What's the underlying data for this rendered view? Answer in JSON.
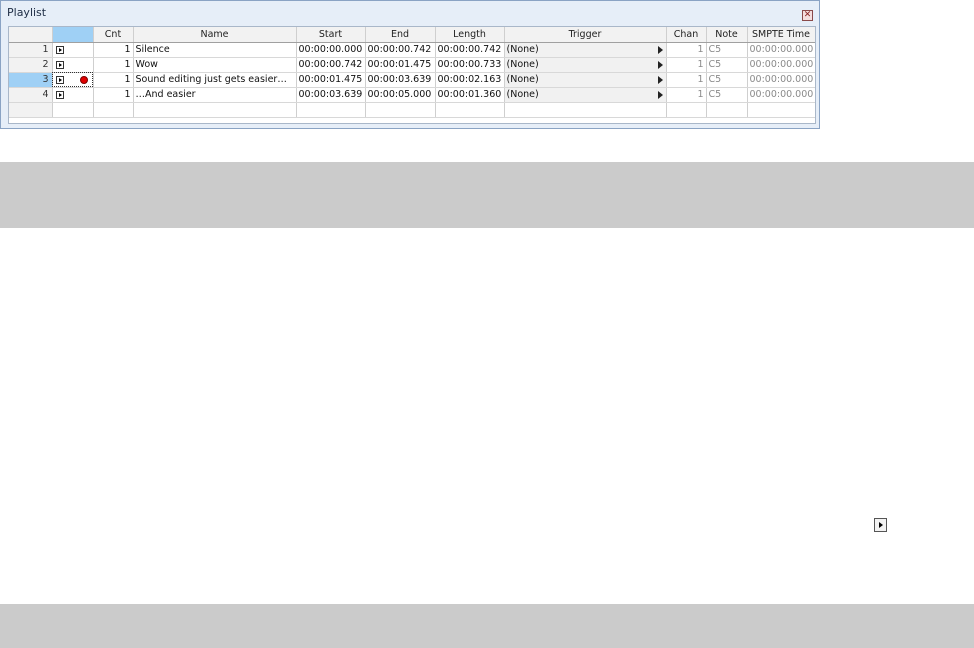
{
  "window": {
    "title": "Playlist",
    "close_glyph": "✕"
  },
  "columns": {
    "control": "",
    "cnt": "Cnt",
    "name": "Name",
    "start": "Start",
    "end": "End",
    "length": "Length",
    "trigger": "Trigger",
    "chan": "Chan",
    "note": "Note",
    "smpte": "SMPTE Time"
  },
  "rows": [
    {
      "num": "1",
      "cnt": "1",
      "name": "Silence",
      "start": "00:00:00.000",
      "end": "00:00:00.742",
      "length": "00:00:00.742",
      "trigger": "(None)",
      "chan": "1",
      "note": "C5",
      "smpte": "00:00:00.000"
    },
    {
      "num": "2",
      "cnt": "1",
      "name": "Wow",
      "start": "00:00:00.742",
      "end": "00:00:01.475",
      "length": "00:00:00.733",
      "trigger": "(None)",
      "chan": "1",
      "note": "C5",
      "smpte": "00:00:00.000"
    },
    {
      "num": "3",
      "cnt": "1",
      "name": "Sound editing just gets easier…",
      "start": "00:00:01.475",
      "end": "00:00:03.639",
      "length": "00:00:02.163",
      "trigger": "(None)",
      "chan": "1",
      "note": "C5",
      "smpte": "00:00:00.000",
      "selected": true,
      "recording": true
    },
    {
      "num": "4",
      "cnt": "1",
      "name": "…And easier",
      "start": "00:00:03.639",
      "end": "00:00:05.000",
      "length": "00:00:01.360",
      "trigger": "(None)",
      "chan": "1",
      "note": "C5",
      "smpte": "00:00:00.000"
    }
  ],
  "icons": {
    "play": "play-button-icon",
    "record": "record-dot-icon",
    "close": "close-icon",
    "trigger_dropdown": "triangle-right-icon"
  },
  "colors": {
    "selection": "#9fd0f5",
    "record": "#e00000",
    "band": "#cbcbcb"
  }
}
